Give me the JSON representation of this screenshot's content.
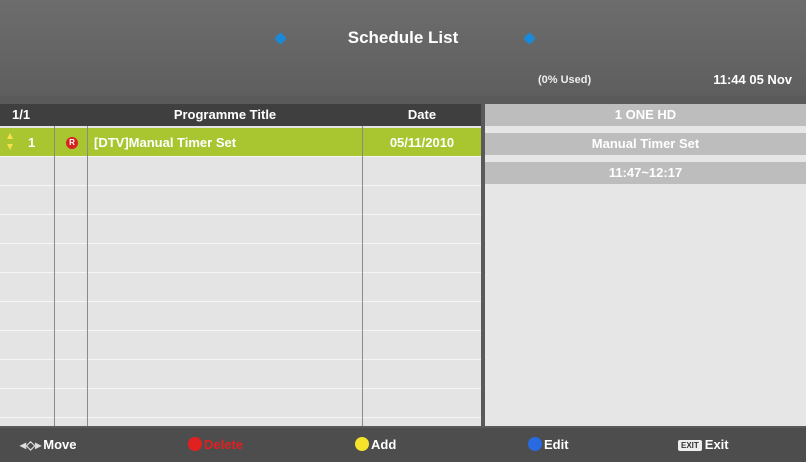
{
  "header": {
    "title": "Schedule List",
    "usage": "(0% Used)",
    "clock": "11:44 05 Nov"
  },
  "table": {
    "page": "1/1",
    "col_title": "Programme Title",
    "col_date": "Date",
    "rows": [
      {
        "num": "1",
        "rec_icon": "R",
        "title": "[DTV]Manual Timer Set",
        "date": "05/11/2010"
      }
    ]
  },
  "info": {
    "channel": "1 ONE HD",
    "event": "Manual Timer Set",
    "time": "11:47~12:17"
  },
  "footer": {
    "move": "Move",
    "delete": "Delete",
    "add": "Add",
    "edit": "Edit",
    "exit_key": "EXIT",
    "exit": "Exit"
  },
  "colors": {
    "selected_row": "#a9c630",
    "header_bg": "#3f3f3f",
    "accent_blue": "#1a8ad8",
    "red_key": "#e12020",
    "yellow_key": "#f4e32a",
    "blue_key": "#2a6ae0"
  }
}
